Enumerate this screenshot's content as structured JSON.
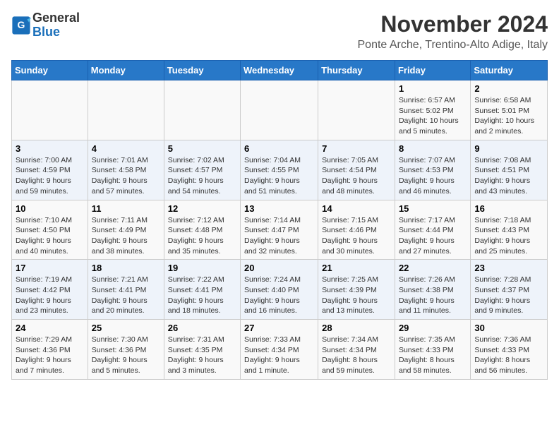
{
  "header": {
    "logo_text_general": "General",
    "logo_text_blue": "Blue",
    "month_title": "November 2024",
    "location": "Ponte Arche, Trentino-Alto Adige, Italy"
  },
  "days_of_week": [
    "Sunday",
    "Monday",
    "Tuesday",
    "Wednesday",
    "Thursday",
    "Friday",
    "Saturday"
  ],
  "weeks": [
    [
      {
        "day": "",
        "info": ""
      },
      {
        "day": "",
        "info": ""
      },
      {
        "day": "",
        "info": ""
      },
      {
        "day": "",
        "info": ""
      },
      {
        "day": "",
        "info": ""
      },
      {
        "day": "1",
        "info": "Sunrise: 6:57 AM\nSunset: 5:02 PM\nDaylight: 10 hours and 5 minutes."
      },
      {
        "day": "2",
        "info": "Sunrise: 6:58 AM\nSunset: 5:01 PM\nDaylight: 10 hours and 2 minutes."
      }
    ],
    [
      {
        "day": "3",
        "info": "Sunrise: 7:00 AM\nSunset: 4:59 PM\nDaylight: 9 hours and 59 minutes."
      },
      {
        "day": "4",
        "info": "Sunrise: 7:01 AM\nSunset: 4:58 PM\nDaylight: 9 hours and 57 minutes."
      },
      {
        "day": "5",
        "info": "Sunrise: 7:02 AM\nSunset: 4:57 PM\nDaylight: 9 hours and 54 minutes."
      },
      {
        "day": "6",
        "info": "Sunrise: 7:04 AM\nSunset: 4:55 PM\nDaylight: 9 hours and 51 minutes."
      },
      {
        "day": "7",
        "info": "Sunrise: 7:05 AM\nSunset: 4:54 PM\nDaylight: 9 hours and 48 minutes."
      },
      {
        "day": "8",
        "info": "Sunrise: 7:07 AM\nSunset: 4:53 PM\nDaylight: 9 hours and 46 minutes."
      },
      {
        "day": "9",
        "info": "Sunrise: 7:08 AM\nSunset: 4:51 PM\nDaylight: 9 hours and 43 minutes."
      }
    ],
    [
      {
        "day": "10",
        "info": "Sunrise: 7:10 AM\nSunset: 4:50 PM\nDaylight: 9 hours and 40 minutes."
      },
      {
        "day": "11",
        "info": "Sunrise: 7:11 AM\nSunset: 4:49 PM\nDaylight: 9 hours and 38 minutes."
      },
      {
        "day": "12",
        "info": "Sunrise: 7:12 AM\nSunset: 4:48 PM\nDaylight: 9 hours and 35 minutes."
      },
      {
        "day": "13",
        "info": "Sunrise: 7:14 AM\nSunset: 4:47 PM\nDaylight: 9 hours and 32 minutes."
      },
      {
        "day": "14",
        "info": "Sunrise: 7:15 AM\nSunset: 4:46 PM\nDaylight: 9 hours and 30 minutes."
      },
      {
        "day": "15",
        "info": "Sunrise: 7:17 AM\nSunset: 4:44 PM\nDaylight: 9 hours and 27 minutes."
      },
      {
        "day": "16",
        "info": "Sunrise: 7:18 AM\nSunset: 4:43 PM\nDaylight: 9 hours and 25 minutes."
      }
    ],
    [
      {
        "day": "17",
        "info": "Sunrise: 7:19 AM\nSunset: 4:42 PM\nDaylight: 9 hours and 23 minutes."
      },
      {
        "day": "18",
        "info": "Sunrise: 7:21 AM\nSunset: 4:41 PM\nDaylight: 9 hours and 20 minutes."
      },
      {
        "day": "19",
        "info": "Sunrise: 7:22 AM\nSunset: 4:41 PM\nDaylight: 9 hours and 18 minutes."
      },
      {
        "day": "20",
        "info": "Sunrise: 7:24 AM\nSunset: 4:40 PM\nDaylight: 9 hours and 16 minutes."
      },
      {
        "day": "21",
        "info": "Sunrise: 7:25 AM\nSunset: 4:39 PM\nDaylight: 9 hours and 13 minutes."
      },
      {
        "day": "22",
        "info": "Sunrise: 7:26 AM\nSunset: 4:38 PM\nDaylight: 9 hours and 11 minutes."
      },
      {
        "day": "23",
        "info": "Sunrise: 7:28 AM\nSunset: 4:37 PM\nDaylight: 9 hours and 9 minutes."
      }
    ],
    [
      {
        "day": "24",
        "info": "Sunrise: 7:29 AM\nSunset: 4:36 PM\nDaylight: 9 hours and 7 minutes."
      },
      {
        "day": "25",
        "info": "Sunrise: 7:30 AM\nSunset: 4:36 PM\nDaylight: 9 hours and 5 minutes."
      },
      {
        "day": "26",
        "info": "Sunrise: 7:31 AM\nSunset: 4:35 PM\nDaylight: 9 hours and 3 minutes."
      },
      {
        "day": "27",
        "info": "Sunrise: 7:33 AM\nSunset: 4:34 PM\nDaylight: 9 hours and 1 minute."
      },
      {
        "day": "28",
        "info": "Sunrise: 7:34 AM\nSunset: 4:34 PM\nDaylight: 8 hours and 59 minutes."
      },
      {
        "day": "29",
        "info": "Sunrise: 7:35 AM\nSunset: 4:33 PM\nDaylight: 8 hours and 58 minutes."
      },
      {
        "day": "30",
        "info": "Sunrise: 7:36 AM\nSunset: 4:33 PM\nDaylight: 8 hours and 56 minutes."
      }
    ]
  ]
}
